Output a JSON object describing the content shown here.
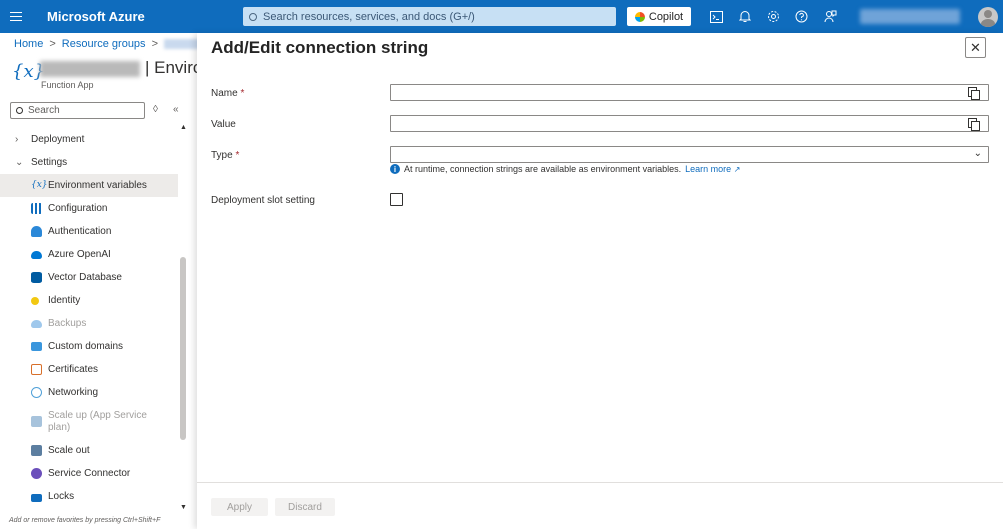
{
  "topbar": {
    "brand": "Microsoft Azure",
    "search_placeholder": "Search resources, services, and docs (G+/)",
    "copilot_label": "Copilot",
    "icons": [
      "cloud-shell-icon",
      "bell-icon",
      "gear-icon",
      "help-icon",
      "feedback-icon"
    ]
  },
  "breadcrumb": {
    "home": "Home",
    "resource_groups": "Resource groups",
    "separator": ">"
  },
  "resource": {
    "icon_glyph": "{x}",
    "title_suffix": "| Envirc",
    "subtitle": "Function App"
  },
  "left_search": {
    "placeholder": "Search",
    "options_glyph": "◊",
    "collapse_glyph": "«"
  },
  "nav": {
    "deployment": "Deployment",
    "settings": "Settings",
    "items": [
      {
        "label": "Environment variables",
        "icon": "variables-icon",
        "color": "#0f6cbd"
      },
      {
        "label": "Configuration",
        "icon": "sliders-icon",
        "color": "#0f6cbd"
      },
      {
        "label": "Authentication",
        "icon": "person-key-icon",
        "color": "#2b88d8"
      },
      {
        "label": "Azure OpenAI",
        "icon": "cloud-icon",
        "color": "#0078d4"
      },
      {
        "label": "Vector Database",
        "icon": "database-icon",
        "color": "#005ba1"
      },
      {
        "label": "Identity",
        "icon": "key-icon",
        "color": "#f2c811"
      },
      {
        "label": "Backups",
        "icon": "backup-cloud-icon",
        "color": "#9fc8ec"
      },
      {
        "label": "Custom domains",
        "icon": "domain-icon",
        "color": "#3a96dd"
      },
      {
        "label": "Certificates",
        "icon": "certificate-icon",
        "color": "#d86f2a"
      },
      {
        "label": "Networking",
        "icon": "network-icon",
        "color": "#50a0d8"
      },
      {
        "label": "Scale up (App Service plan)",
        "icon": "scale-up-icon",
        "color": "#a7c3dc"
      },
      {
        "label": "Scale out",
        "icon": "scale-out-icon",
        "color": "#5c7ea0"
      },
      {
        "label": "Service Connector",
        "icon": "connector-icon",
        "color": "#6b4fbb"
      },
      {
        "label": "Locks",
        "icon": "lock-icon",
        "color": "#0f6cbd"
      }
    ]
  },
  "footer_hint": "Add or remove favorites by pressing Ctrl+Shift+F",
  "blade": {
    "title": "Add/Edit connection string",
    "close_glyph": "✕",
    "name_label": "Name",
    "value_label": "Value",
    "type_label": "Type",
    "required_mark": "*",
    "info_text": "At runtime, connection strings are available as environment variables.",
    "learn_more": "Learn more",
    "slot_label": "Deployment slot setting",
    "apply_label": "Apply",
    "discard_label": "Discard"
  }
}
